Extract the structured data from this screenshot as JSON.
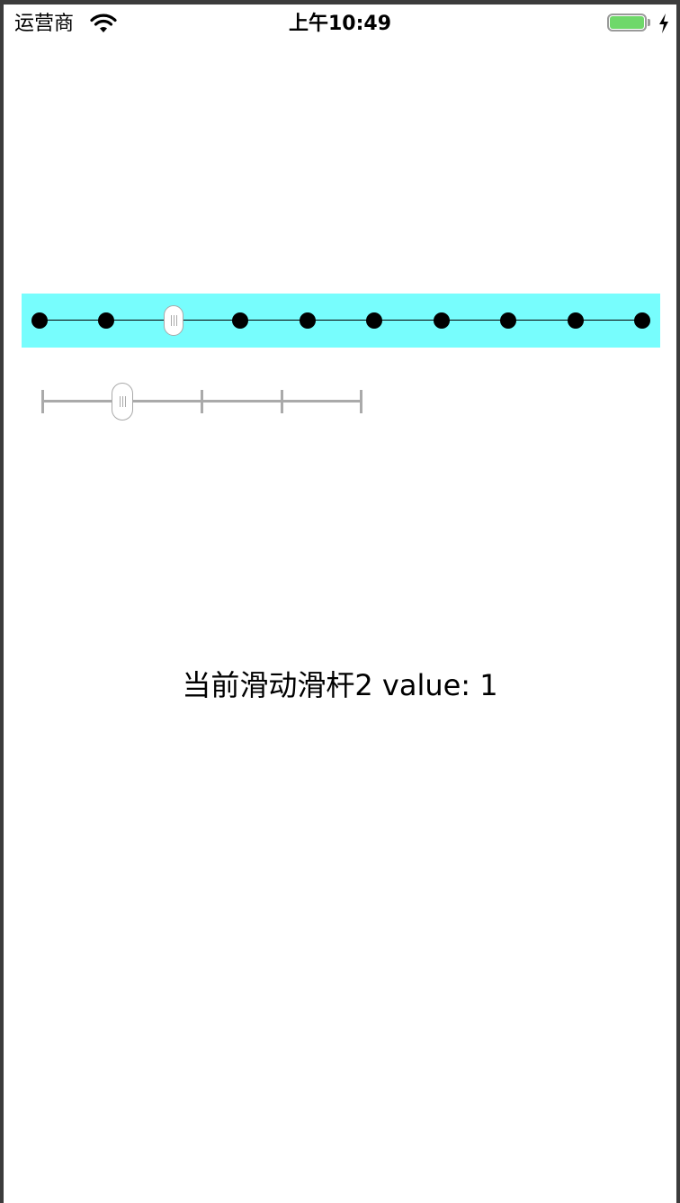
{
  "status_bar": {
    "carrier": "运营商",
    "time": "上午10:49",
    "battery_color": "#6fd86a"
  },
  "slider1": {
    "background_color": "#77fdfd",
    "positions": 10,
    "selected_index": 2,
    "icons": [
      "dot-icon",
      "thumb-handle-icon"
    ]
  },
  "slider2": {
    "positions": 5,
    "selected_index": 1,
    "track_color": "#aaaaaa"
  },
  "status_text": "当前滑动滑杆2 value: 1"
}
